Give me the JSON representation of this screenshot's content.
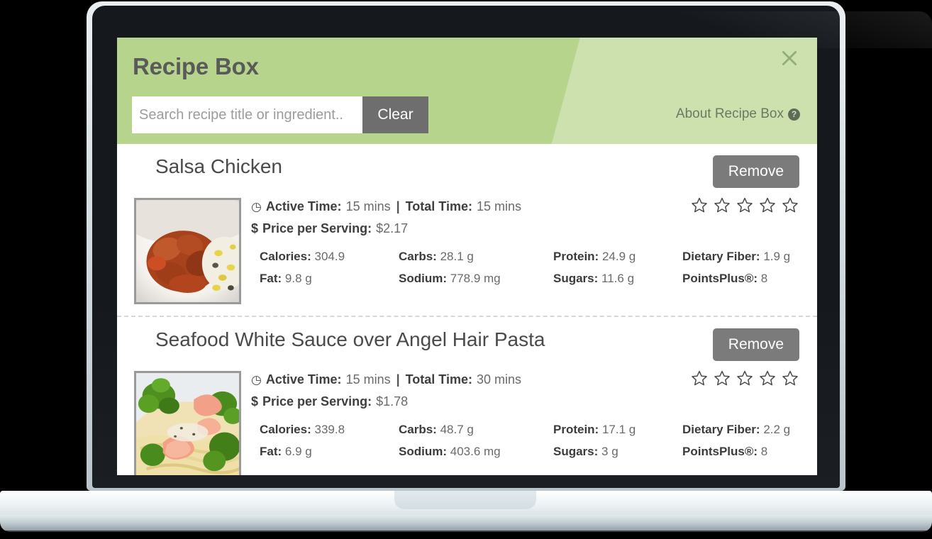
{
  "app": {
    "title": "Recipe Box",
    "close_label": "×",
    "about_label": "About Recipe Box",
    "help_icon_label": "?"
  },
  "search": {
    "value": "",
    "placeholder": "Search recipe title or ingredient..",
    "clear_label": "Clear"
  },
  "labels": {
    "active_time": "Active Time:",
    "total_time": "Total Time:",
    "price_per_serving": "Price per Serving:",
    "separator": "|",
    "dollar_sign": "$",
    "remove": "Remove",
    "calories": "Calories:",
    "carbs": "Carbs:",
    "protein": "Protein:",
    "dietary_fiber": "Dietary Fiber:",
    "fat": "Fat:",
    "sodium": "Sodium:",
    "sugars": "Sugars:",
    "pointsplus": "PointsPlus®:"
  },
  "colors": {
    "header_green": "#b6d48b",
    "header_green_light": "#c9e2a3",
    "button_gray": "#7b7b7b",
    "clear_gray": "#6e6e6e",
    "title_gray": "#5a5a5a",
    "bezel_dark": "#15181c"
  },
  "recipes": [
    {
      "title": "Salsa Chicken",
      "active_time": "15 mins",
      "total_time": "15 mins",
      "price": "$2.17",
      "rating": 0,
      "rating_max": 5,
      "nutrition": {
        "calories": "304.9",
        "carbs": "28.1 g",
        "protein": "24.9 g",
        "dietary_fiber": "1.9 g",
        "fat": "9.8 g",
        "sodium": "778.9 mg",
        "sugars": "11.6 g",
        "pointsplus": "8"
      }
    },
    {
      "title": "Seafood White Sauce over Angel Hair Pasta",
      "active_time": "15 mins",
      "total_time": "30 mins",
      "price": "$1.78",
      "rating": 0,
      "rating_max": 5,
      "nutrition": {
        "calories": "339.8",
        "carbs": "48.7 g",
        "protein": "17.1 g",
        "dietary_fiber": "2.2 g",
        "fat": "6.9 g",
        "sodium": "403.6 mg",
        "sugars": "3 g",
        "pointsplus": "8"
      }
    }
  ]
}
